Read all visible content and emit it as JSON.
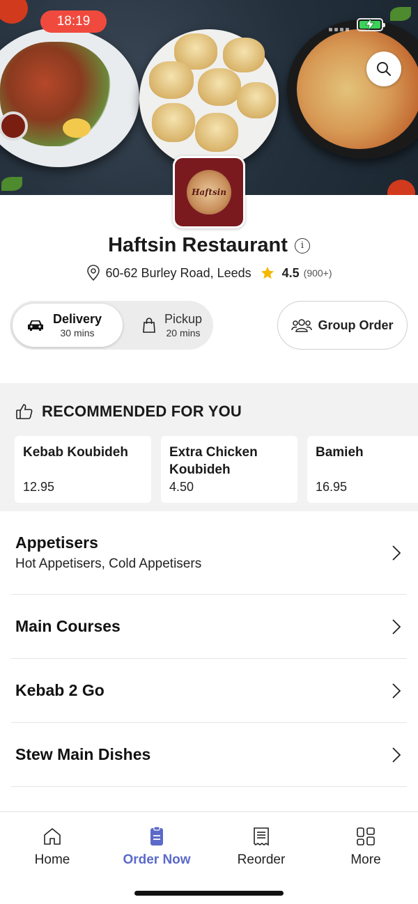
{
  "status_bar": {
    "time": "18:19"
  },
  "restaurant": {
    "name": "Haftsin Restaurant",
    "logo_text": "Haftsin",
    "address": "60-62 Burley Road, Leeds",
    "rating": "4.5",
    "rating_count": "(900+)"
  },
  "order_modes": [
    {
      "label": "Delivery",
      "time": "30 mins",
      "icon": "car-icon",
      "selected": true
    },
    {
      "label": "Pickup",
      "time": "20 mins",
      "icon": "shopping-bag-icon",
      "selected": false
    }
  ],
  "group_order": {
    "label": "Group Order",
    "icon": "group-icon"
  },
  "recommended": {
    "heading": "RECOMMENDED FOR YOU",
    "items": [
      {
        "name": "Kebab Koubideh",
        "price": "12.95"
      },
      {
        "name": "Extra Chicken Koubideh",
        "price": "4.50"
      },
      {
        "name": "Bamieh",
        "price": "16.95"
      }
    ]
  },
  "menu_sections": [
    {
      "title": "Appetisers",
      "subtitle": "Hot Appetisers, Cold Appetisers"
    },
    {
      "title": "Main Courses"
    },
    {
      "title": "Kebab 2 Go"
    },
    {
      "title": "Stew Main Dishes"
    }
  ],
  "tabs": [
    {
      "label": "Home",
      "icon": "home-icon"
    },
    {
      "label": "Order Now",
      "icon": "order-icon",
      "active": true
    },
    {
      "label": "Reorder",
      "icon": "receipt-icon"
    },
    {
      "label": "More",
      "icon": "grid-icon"
    }
  ],
  "colors": {
    "accent": "#5b6ac8",
    "time_pill": "#f04a3e",
    "star": "#f5b800",
    "battery": "#3bd15b"
  }
}
